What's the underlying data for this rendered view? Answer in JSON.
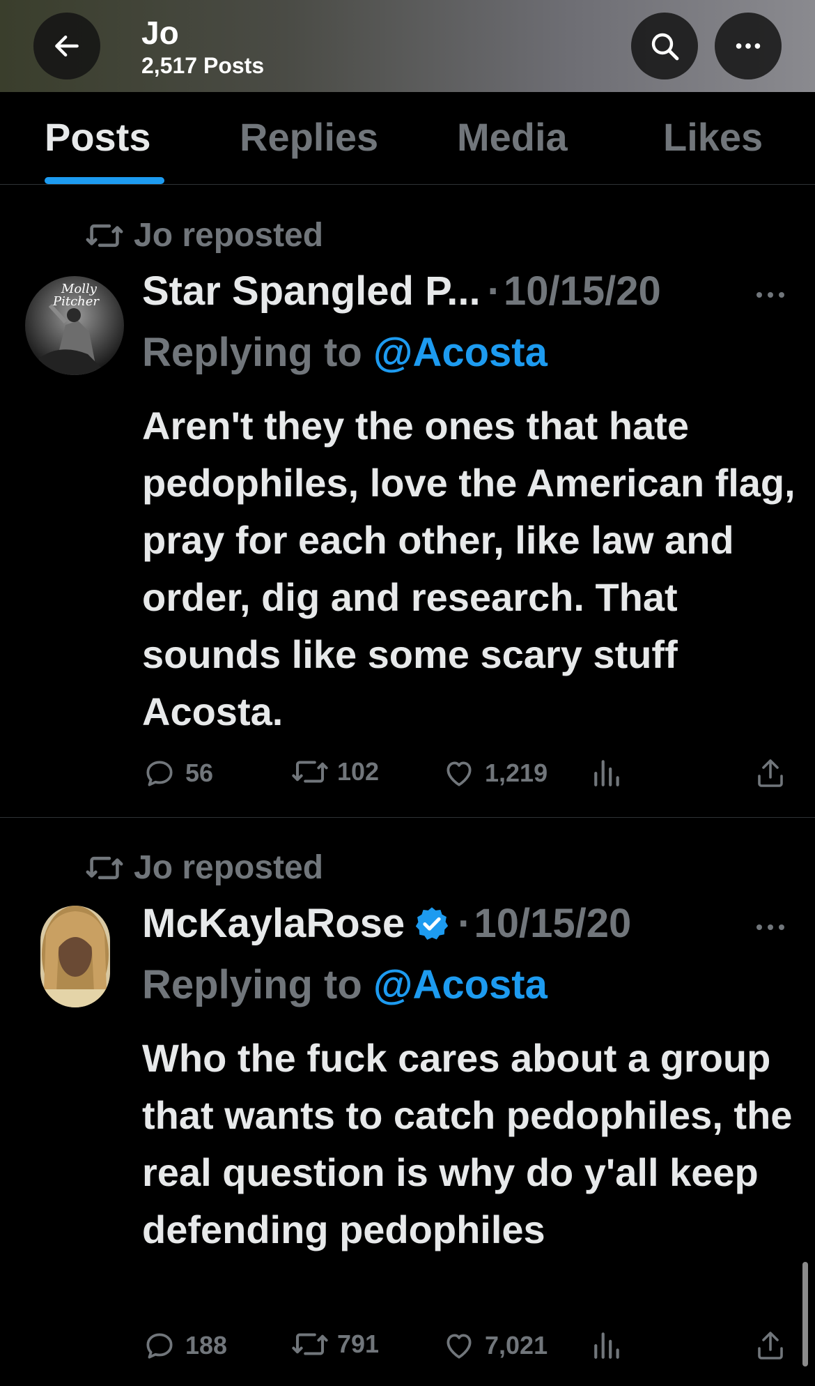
{
  "header": {
    "title": "Jo",
    "subtitle": "2,517 Posts",
    "back_icon": "arrow-left-icon",
    "search_icon": "search-icon",
    "more_icon": "more-horizontal-icon",
    "background_colors": [
      "#3a3e2c",
      "#8a8a8f"
    ]
  },
  "tabs": [
    {
      "label": "Posts",
      "active": true
    },
    {
      "label": "Replies",
      "active": false
    },
    {
      "label": "Media",
      "active": false
    },
    {
      "label": "Likes",
      "active": false
    }
  ],
  "colors": {
    "background": "#000000",
    "text": "#e7e9ea",
    "muted": "#71767b",
    "accent": "#1d9bf0",
    "divider": "#2f3336"
  },
  "posts": [
    {
      "repost_label": "Jo reposted",
      "author": "Star Spangled P...",
      "separator": "·",
      "date": "10/15/20",
      "verified": false,
      "avatar_text": [
        "Molly",
        "Pitcher"
      ],
      "replying_prefix": "Replying to",
      "replying_handle": "@Acosta",
      "text": "Aren't they the ones that hate pedophiles, love the American flag, pray for each other, like law and order, dig and research.  That sounds like some scary stuff Acosta.",
      "replies": "56",
      "reposts": "102",
      "likes": "1,219"
    },
    {
      "repost_label": "Jo reposted",
      "author": "McKaylaRose",
      "separator": "·",
      "date": "10/15/20",
      "verified": true,
      "replying_prefix": "Replying to",
      "replying_handle": "@Acosta",
      "text": "Who the fuck cares about a group that wants to catch pedophiles, the real question is why do y'all keep defending pedophiles",
      "replies": "188",
      "reposts": "791",
      "likes": "7,021"
    }
  ]
}
